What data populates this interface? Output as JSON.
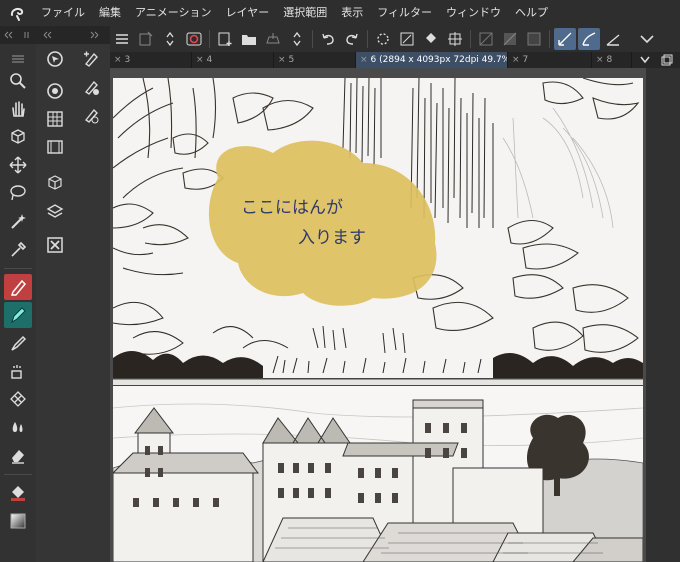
{
  "menu": {
    "logo_icon": "clip-studio-logo-icon",
    "items": [
      "ファイル",
      "編集",
      "アニメーション",
      "レイヤー",
      "選択範囲",
      "表示",
      "フィルター",
      "ウィンドウ",
      "ヘルプ"
    ]
  },
  "tabs": [
    {
      "label": "3"
    },
    {
      "label": "4"
    },
    {
      "label": "5"
    },
    {
      "label": "6 (2894 x 4093px 72dpi 49.7%)",
      "active": true
    },
    {
      "label": "7"
    },
    {
      "label": "8"
    }
  ],
  "artwork": {
    "note_line1": "ここにはんが",
    "note_line2": "入ります",
    "note_color": "#dcbf5e"
  },
  "colors": {
    "active_tool": "#c04040",
    "active_tab": "#3d4f66"
  }
}
